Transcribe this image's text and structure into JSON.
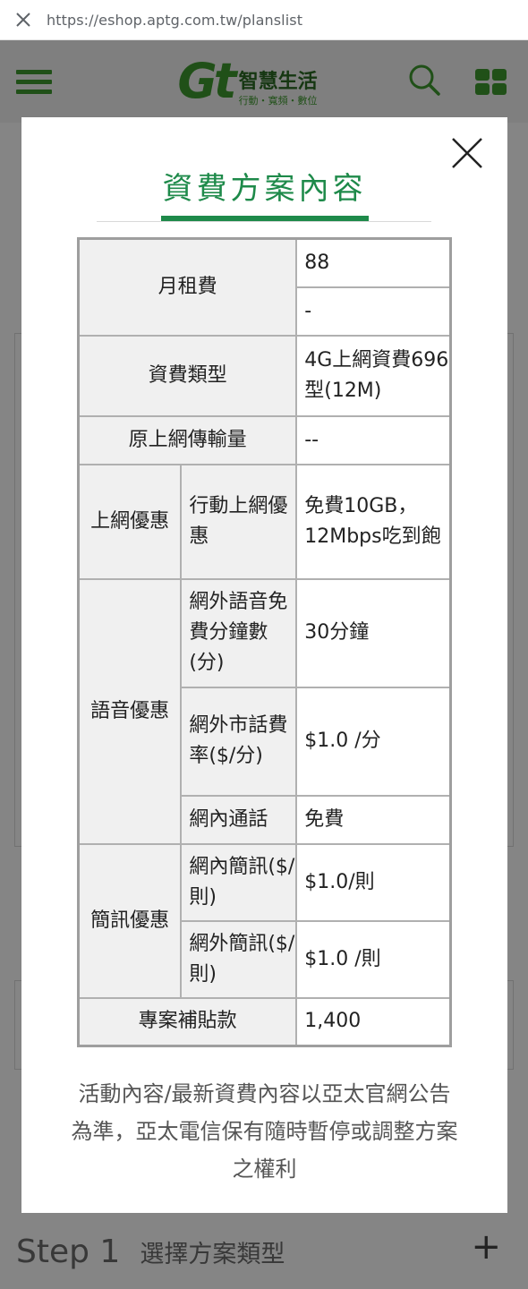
{
  "browser": {
    "url": "https://eshop.aptg.com.tw/planslist"
  },
  "header": {
    "logo_mark": "Gt",
    "logo_title": "智慧生活",
    "logo_subtitle": "行動・寬頻・數位"
  },
  "background": {
    "step_number": "Step 1",
    "step_label": "選擇方案類型"
  },
  "modal": {
    "title": "資費方案內容",
    "table": {
      "monthly_fee_label": "月租費",
      "monthly_fee_value": "88",
      "monthly_fee_value2": "-",
      "plan_type_label": "資費類型",
      "plan_type_value": "4G上網資費696型(12M)",
      "original_data_label": "原上網傳輸量",
      "original_data_value": "--",
      "data_offer_label": "上網優惠",
      "mobile_data_label": "行動上網優惠",
      "mobile_data_value": "免費10GB，12Mbps吃到飽",
      "voice_offer_label": "語音優惠",
      "offnet_minutes_label": "網外語音免費分鐘數(分)",
      "offnet_minutes_value": "30分鐘",
      "offnet_landline_label": "網外市話費率($/分)",
      "offnet_landline_value": "$1.0 /分",
      "onnet_call_label": "網內通話",
      "onnet_call_value": "免費",
      "sms_offer_label": "簡訊優惠",
      "onnet_sms_label": "網內簡訊($/則)",
      "onnet_sms_value": "$1.0/則",
      "offnet_sms_label": "網外簡訊($/則)",
      "offnet_sms_value": "$1.0 /則",
      "subsidy_label": "專案補貼款",
      "subsidy_value": "1,400"
    },
    "note": "活動內容/最新資費內容以亞太官網公告為準，亞太電信保有隨時暫停或調整方案之權利"
  }
}
